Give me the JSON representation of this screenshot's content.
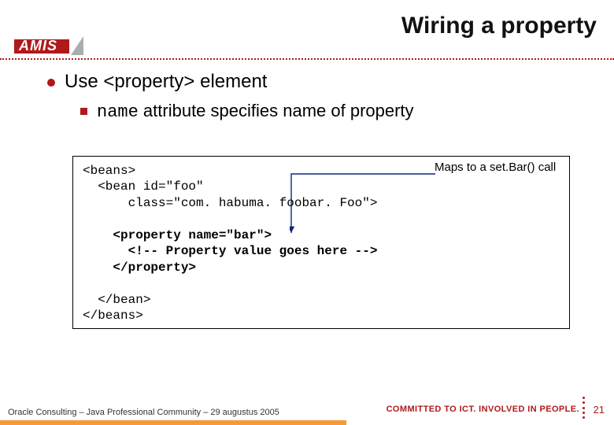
{
  "logo": {
    "text": "AMIS"
  },
  "title": "Wiring a property",
  "bullets": {
    "level1": "Use <property> element",
    "level2_prefix_code": "name",
    "level2_rest": " attribute specifies name of property"
  },
  "code": {
    "line1": "<beans>",
    "line2": "  <bean id=\"foo\"",
    "line3": "      class=\"com. habuma. foobar. Foo\">",
    "blank1": "",
    "bold1": "    <property name=\"bar\">",
    "bold2": "      <!-- Property value goes here -->",
    "bold3": "    </property>",
    "blank2": "",
    "line7": "  </bean>",
    "line8": "</beans>"
  },
  "annotation": "Maps to a set.Bar() call",
  "footer": {
    "left": "Oracle Consulting – Java Professional Community – 29 augustus 2005",
    "right": "COMMITTED TO ICT. INVOLVED IN PEOPLE.",
    "page": "21"
  }
}
